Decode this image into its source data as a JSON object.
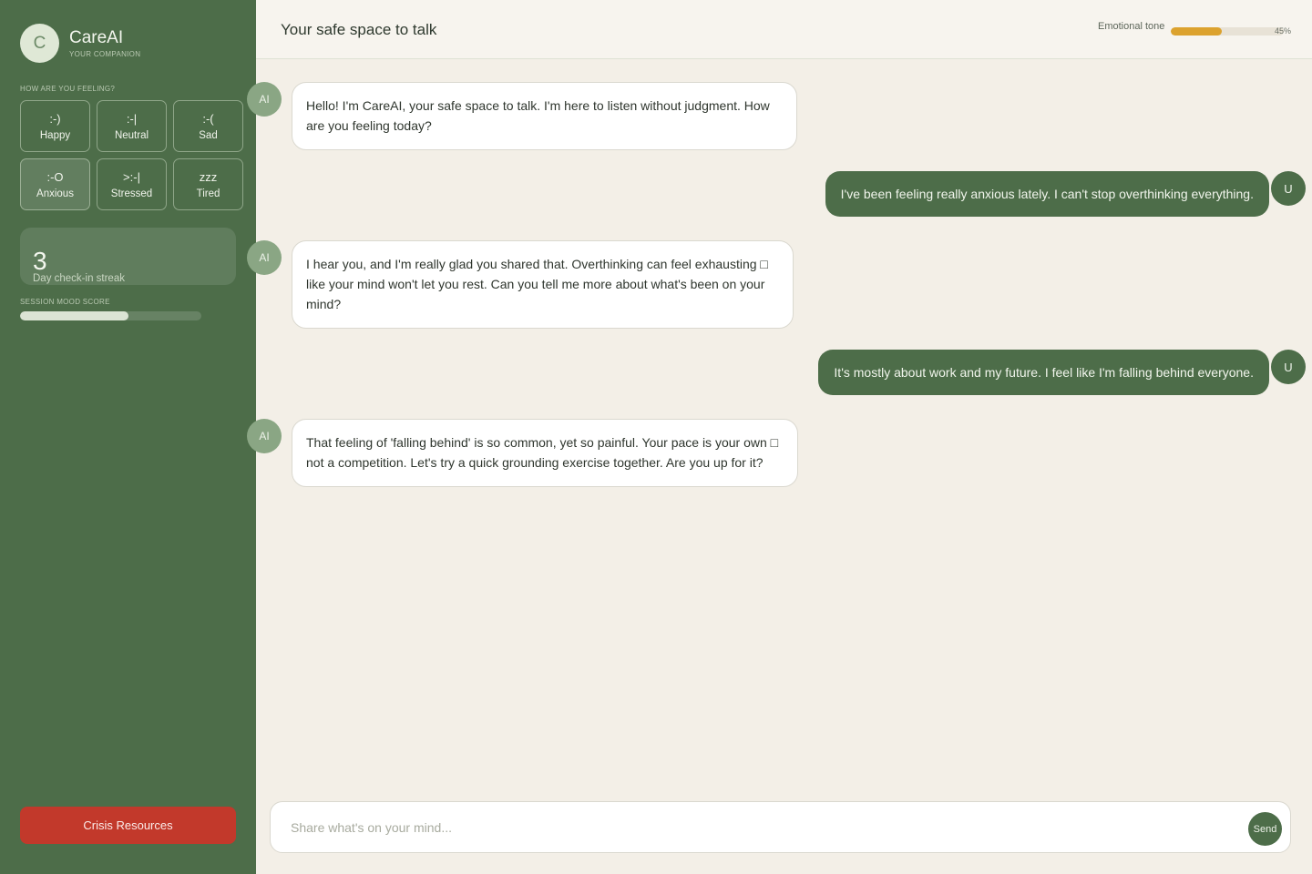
{
  "sidebar": {
    "brand": {
      "initial": "C",
      "name": "CareAI",
      "subtitle": "YOUR COMPANION"
    },
    "mood_prompt": "HOW ARE YOU FEELING?",
    "moods": [
      {
        "glyph": ":-)",
        "label": "Happy",
        "selected": false
      },
      {
        "glyph": ":-|",
        "label": "Neutral",
        "selected": false
      },
      {
        "glyph": ":-(",
        "label": "Sad",
        "selected": false
      },
      {
        "glyph": ":-O",
        "label": "Anxious",
        "selected": true
      },
      {
        "glyph": ">:-|",
        "label": "Stressed",
        "selected": false
      },
      {
        "glyph": "zzz",
        "label": "Tired",
        "selected": false
      }
    ],
    "streak": {
      "value": "3",
      "label": "Day check-in streak"
    },
    "session_mood": {
      "label": "SESSION MOOD SCORE",
      "fraction": 0.6
    },
    "crisis_label": "Crisis Resources"
  },
  "header": {
    "title": "Your safe space to talk",
    "tone_label": "Emotional tone",
    "tone_percent": 45,
    "tone_percent_text": "45%"
  },
  "messages": [
    {
      "sender": "ai",
      "avatar": "AI",
      "text": "Hello! I'm CareAI, your safe space to talk. I'm here to listen without judgment. How are you feeling today?"
    },
    {
      "sender": "user",
      "avatar": "U",
      "text": "I've been feeling really anxious lately. I can't stop overthinking everything."
    },
    {
      "sender": "ai",
      "avatar": "AI",
      "text": "I hear you, and I'm really glad you shared that. Overthinking can feel exhausting □ like your mind won't let you rest. Can you tell me more about what's been on your mind?"
    },
    {
      "sender": "user",
      "avatar": "U",
      "text": "It's mostly about work and my future. I feel like I'm falling behind everyone."
    },
    {
      "sender": "ai",
      "avatar": "AI",
      "text": "That feeling of 'falling behind' is so common, yet so painful. Your pace is your own □ not a competition. Let's try a quick grounding exercise together. Are you up for it?"
    }
  ],
  "composer": {
    "placeholder": "Share what's on your mind...",
    "send_label": "Send"
  },
  "colors": {
    "sidebar": "#4d6d49",
    "accent_green": "#4d6d49",
    "tone_bar": "#dca22e",
    "crisis": "#c2392b",
    "background": "#f3efe7"
  }
}
